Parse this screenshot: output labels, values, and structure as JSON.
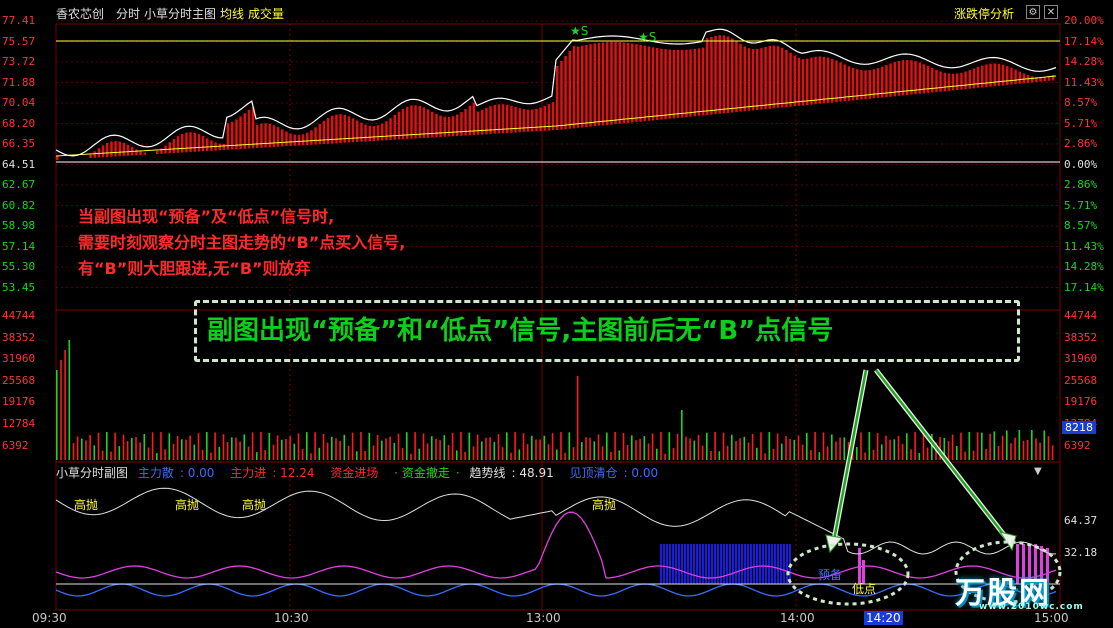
{
  "header": {
    "stock_name": "香农芯创",
    "mode": "分时",
    "indicator_name": "小草分时主图",
    "avg_line": "均线",
    "volume": "成交量",
    "panel_title": "涨跌停分析"
  },
  "price_axis_left": [
    "77.41",
    "75.57",
    "73.72",
    "71.88",
    "70.04",
    "68.20",
    "66.35",
    "64.51",
    "62.67",
    "60.82",
    "58.98",
    "57.14",
    "55.30",
    "53.45"
  ],
  "price_axis_right": [
    "20.00%",
    "17.14%",
    "14.28%",
    "11.43%",
    "8.57%",
    "5.71%",
    "2.86%",
    "0.00%",
    "2.86%",
    "5.71%",
    "8.57%",
    "11.43%",
    "14.28%",
    "17.14%"
  ],
  "volume_axis_left": [
    "44744",
    "38352",
    "31960",
    "25568",
    "19176",
    "12784",
    "6392"
  ],
  "volume_axis_right": [
    "44744",
    "38352",
    "31960",
    "25568",
    "19176",
    "12784",
    "6392"
  ],
  "volume_current": "8218",
  "sub_axis_right": [
    "64.37",
    "32.18"
  ],
  "signals": {
    "b_label": "B",
    "s_label": "S"
  },
  "annotation_main": [
    "当副图出现“预备”及“低点”信号时,",
    "需要时刻观察分时主图走势的“B”点买入信号,",
    "有“B”则大胆跟进,无“B”则放弃"
  ],
  "annotation_box": "副图出现“预备”和“低点”信号,主图前后无“B”点信号",
  "sub_chart": {
    "title": "小草分时副图",
    "legend": [
      {
        "label": "主力散",
        "value": "0.00",
        "color": "#3a6cff"
      },
      {
        "label": "主力进",
        "value": "12.24",
        "color": "#ff2a2a"
      },
      {
        "label": "资金进场",
        "value": "",
        "color": "#ff2a2a"
      },
      {
        "label": "资金撤走",
        "value": "",
        "color": "#1cd61c"
      },
      {
        "label": "趋势线",
        "value": "48.91",
        "color": "#e0e0e0"
      },
      {
        "label": "见顶清仓",
        "value": "0.00",
        "color": "#3a6cff"
      }
    ],
    "high_sell_label": "高抛",
    "prep_label": "预备",
    "low_label": "低点"
  },
  "time_axis": [
    "09:30",
    "10:30",
    "13:00",
    "14:00",
    "14:20",
    "15:00"
  ],
  "logo_text": "万股网",
  "logo_domain": "www.2010wc.com",
  "colors": {
    "up": "#ff1a1a",
    "down": "#1cd61c",
    "price_line": "#ffffff",
    "avg_line": "#ffff33",
    "grid": "#8b0000",
    "axis_red": "#ff3333",
    "axis_green": "#1cd61c"
  }
}
